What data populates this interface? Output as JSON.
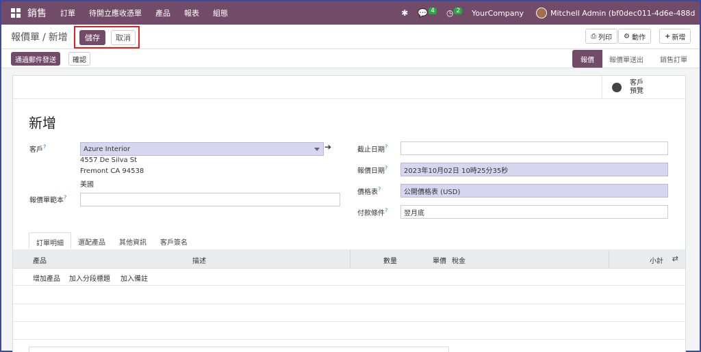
{
  "topbar": {
    "app_name": "銷售",
    "menu": [
      "訂單",
      "待開立應收憑單",
      "產品",
      "報表",
      "組態"
    ],
    "messages_count": "4",
    "activities_count": "2",
    "company": "YourCompany",
    "user": "Mitchell Admin (bf0dec011-4d6e-488d-..."
  },
  "control": {
    "breadcrumb_parent": "報價單",
    "breadcrumb_current": "新增",
    "save_label": "儲存",
    "cancel_label": "取消",
    "print_label": "列印",
    "action_label": "動作",
    "new_label": "新增"
  },
  "statusbar": {
    "send_email_label": "通過郵件發送",
    "confirm_label": "確認",
    "stages": [
      "報價",
      "報價單送出",
      "銷售訂單"
    ],
    "active_stage": "報價"
  },
  "sheet": {
    "preview_line1": "客戶",
    "preview_line2": "預覽",
    "title": "新增",
    "customer_label": "客戶",
    "customer_value": "Azure Interior",
    "address": [
      "4557 De Silva St",
      "Fremont CA 94538",
      "美國"
    ],
    "template_label": "報價單範本",
    "template_value": "",
    "expiration_label": "截止日期",
    "expiration_value": "",
    "quote_date_label": "報價日期",
    "quote_date_value": "2023年10月02日 10時25分35秒",
    "pricelist_label": "價格表",
    "pricelist_value": "公開價格表 (USD)",
    "payment_terms_label": "付款條件",
    "payment_terms_value": "翌月底",
    "help_mark": "?"
  },
  "tabs": [
    "訂單明細",
    "選配產品",
    "其他資訊",
    "客戶簽名"
  ],
  "table": {
    "columns": {
      "product": "產品",
      "description": "描述",
      "quantity": "數量",
      "unit_price": "單價",
      "taxes": "稅金",
      "subtotal": "小計"
    },
    "add_product": "增加產品",
    "add_section": "加入分段標題",
    "add_note": "加入備註"
  }
}
